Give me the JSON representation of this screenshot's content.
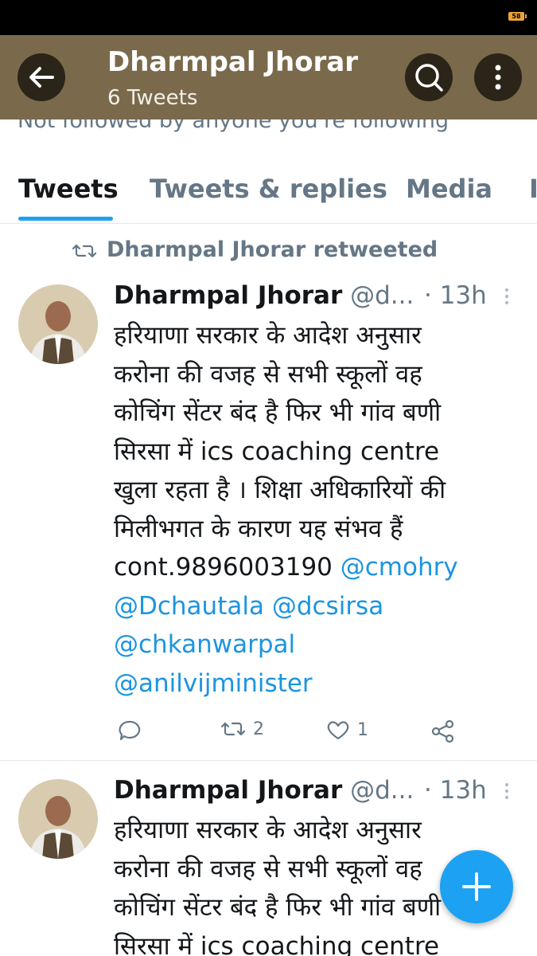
{
  "status_bar": {
    "battery": "58"
  },
  "header": {
    "title": "Dharmpal Jhorar",
    "subtitle": "6 Tweets",
    "follow_note": "Not followed by anyone you're following"
  },
  "tabs": [
    {
      "label": "Tweets",
      "active": true
    },
    {
      "label": "Tweets & replies",
      "active": false
    },
    {
      "label": "Media",
      "active": false
    }
  ],
  "retweet_label": "Dharmpal Jhorar retweeted",
  "tweets": [
    {
      "name": "Dharmpal Jhorar",
      "handle": "@d...",
      "time": "· 13h",
      "lines": [
        "हरियाणा सरकार के आदेश अनुसार",
        "करोना की वजह से सभी स्कूलों वह",
        "कोचिंग सेंटर  बंद है फिर भी गांव बणी",
        "सिरसा में  ics coaching centre",
        "खुला रहता है । शिक्षा अधिकारियों की",
        "मिलीभगत के कारण यह संभव हैं",
        "cont.9896003190"
      ],
      "mentions": [
        "@cmohry",
        "@Dchautala",
        "@dcsirsa",
        "@chkanwarpal",
        "@anilvijminister"
      ],
      "retweets": "2",
      "likes": "1"
    },
    {
      "name": "Dharmpal Jhorar",
      "handle": "@d...",
      "time": "· 13h",
      "lines": [
        "हरियाणा सरकार के आदेश अनुसार",
        "करोना की वजह से सभी स्कूलों वह",
        "कोचिंग सेंटर  बंद है फिर भी गांव बणी",
        "सिरसा में  ics coaching centre"
      ]
    }
  ],
  "colors": {
    "header_bg": "#7a6a4b",
    "accent": "#1da1f2",
    "mention": "#1b95e0",
    "secondary_text": "#657786"
  }
}
